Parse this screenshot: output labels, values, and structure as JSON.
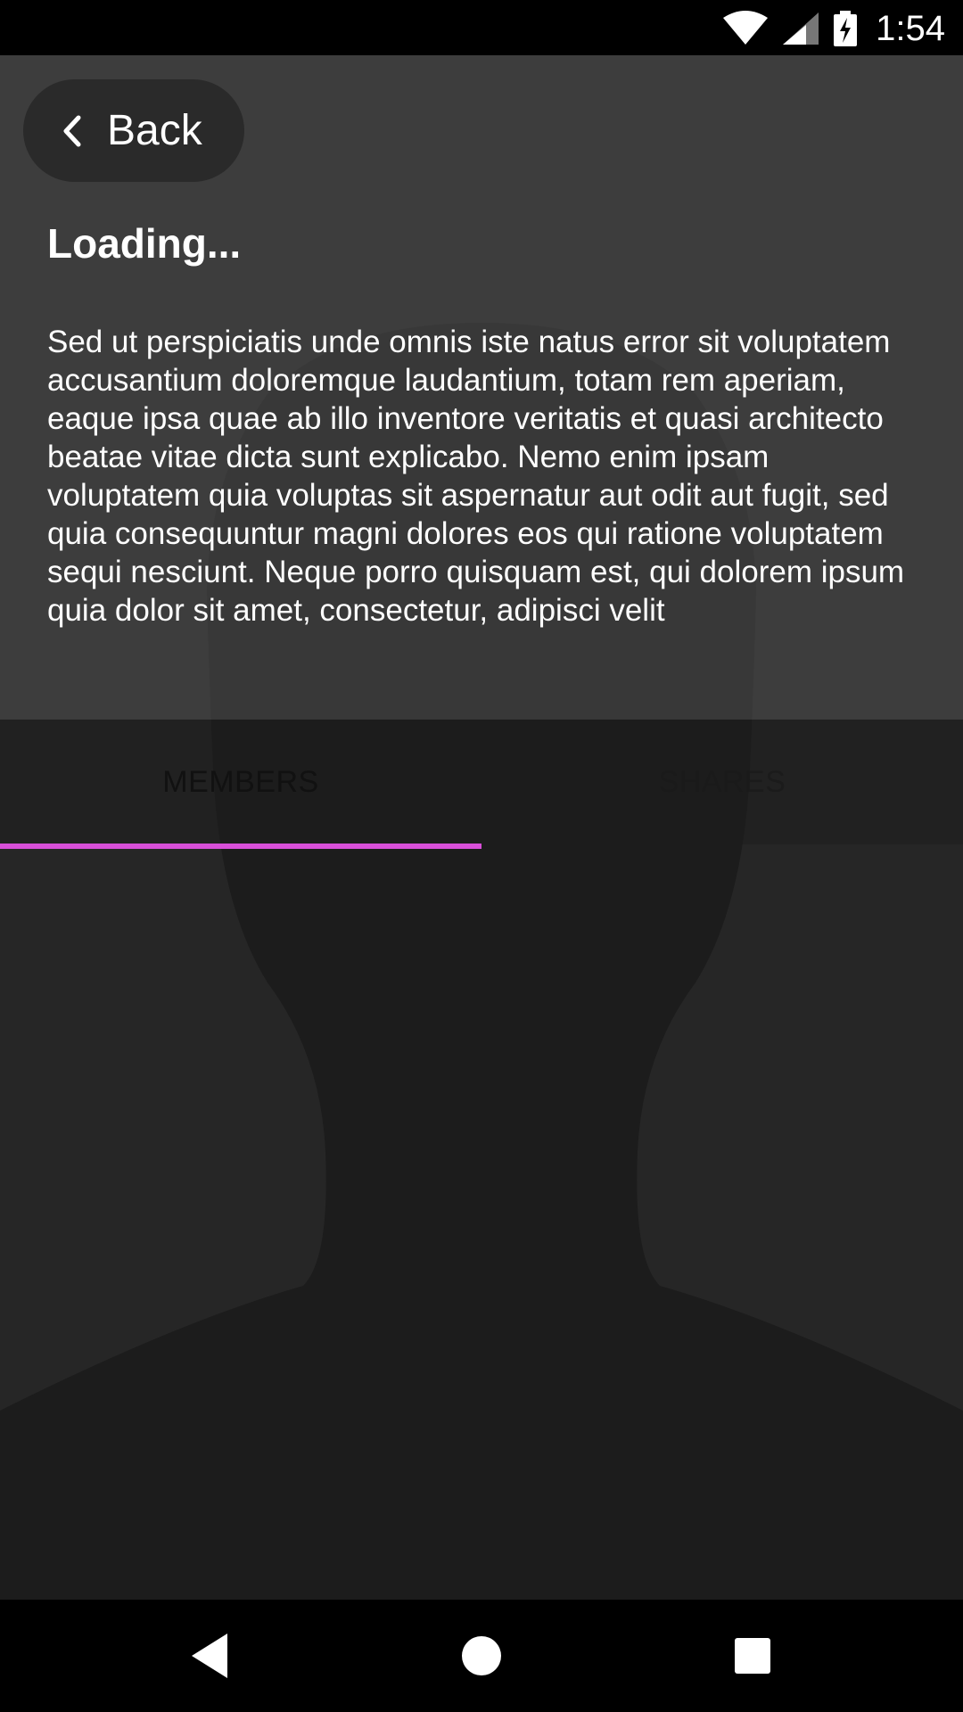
{
  "status_bar": {
    "time": "1:54",
    "icons": [
      "wifi-icon",
      "cell-signal-icon",
      "battery-charging-icon"
    ]
  },
  "header": {
    "back_label": "Back",
    "title": "Loading...",
    "description": "Sed ut perspiciatis unde omnis iste natus error sit voluptatem accusantium doloremque laudantium, totam rem aperiam, eaque ipsa quae ab illo inventore veritatis et quasi architecto beatae vitae dicta sunt explicabo. Nemo enim ipsam voluptatem quia voluptas sit aspernatur aut odit aut fugit, sed quia consequuntur magni dolores eos qui ratione voluptatem sequi nesciunt. Neque porro quisquam est, qui dolorem ipsum quia dolor sit amet, consectetur, adipisci velit"
  },
  "tabs": [
    {
      "label": "MEMBERS",
      "selected": true
    },
    {
      "label": "SHARES",
      "selected": false
    }
  ],
  "colors": {
    "accent": "#d94fd9",
    "background": "#1e1e1e"
  },
  "nav_bar": {
    "buttons": [
      "back-triangle-icon",
      "home-circle-icon",
      "recents-square-icon"
    ]
  }
}
